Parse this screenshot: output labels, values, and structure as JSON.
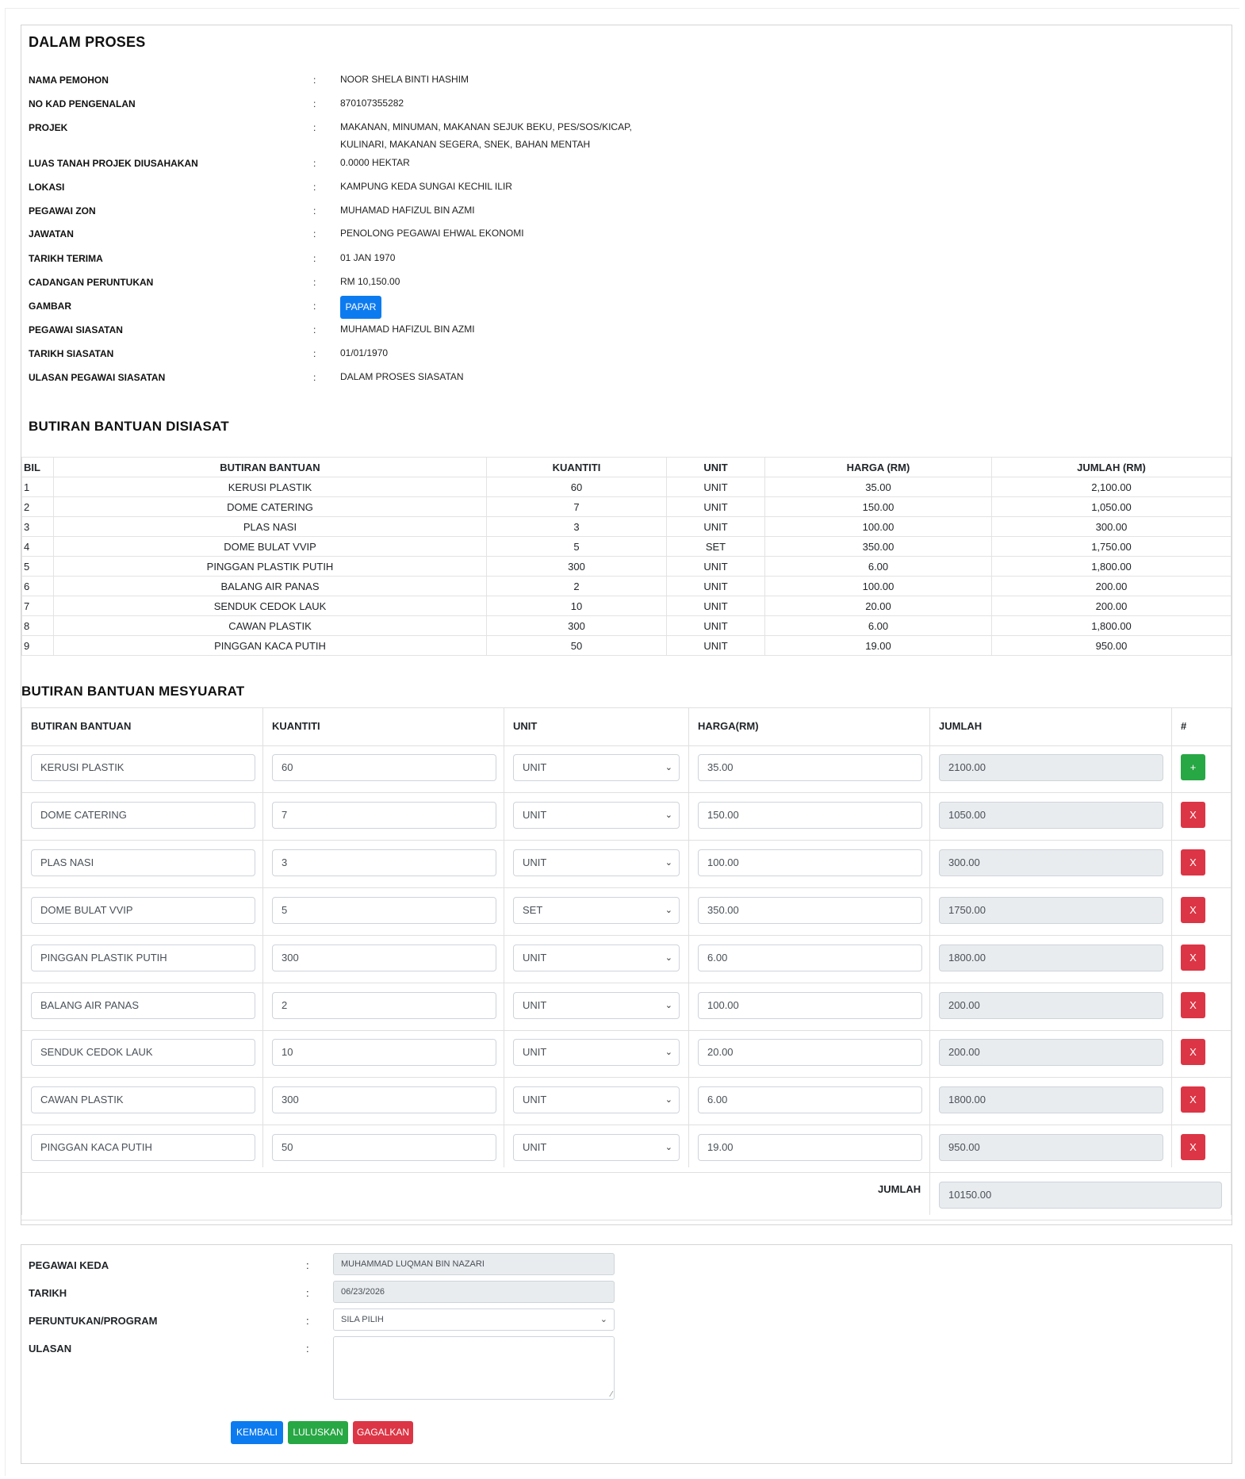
{
  "status_title": "DALAM PROSES",
  "info": [
    {
      "label": "NAMA PEMOHON",
      "value": "NOOR SHELA BINTI HASHIM"
    },
    {
      "label": "NO KAD PENGENALAN",
      "value": "870107355282"
    },
    {
      "label": "PROJEK",
      "value": "MAKANAN, MINUMAN, MAKANAN SEJUK BEKU, PES/SOS/KICAP, KULINARI, MAKANAN SEGERA, SNEK, BAHAN MENTAH"
    },
    {
      "label": "LUAS TANAH PROJEK DIUSAHAKAN",
      "value": "0.0000 HEKTAR"
    },
    {
      "label": "LOKASI",
      "value": "KAMPUNG KEDA SUNGAI KECHIL ILIR"
    },
    {
      "label": "PEGAWAI ZON",
      "value": "MUHAMAD HAFIZUL BIN AZMI"
    },
    {
      "label": "JAWATAN",
      "value": "PENOLONG PEGAWAI EHWAL EKONOMI"
    },
    {
      "label": "TARIKH TERIMA",
      "value": "01 JAN 1970"
    },
    {
      "label": "CADANGAN PERUNTUKAN",
      "value": "RM 10,150.00"
    },
    {
      "label": "GAMBAR",
      "value": ""
    },
    {
      "label": "PEGAWAI SIASATAN",
      "value": "MUHAMAD HAFIZUL BIN AZMI"
    },
    {
      "label": "TARIKH SIASATAN",
      "value": "01/01/1970"
    },
    {
      "label": "ULASAN PEGAWAI SIASATAN",
      "value": "DALAM PROSES SIASATAN"
    }
  ],
  "colon": ":",
  "papar_button": "PAPAR",
  "disiasat": {
    "title": "BUTIRAN BANTUAN DISIASAT",
    "headers": [
      "BIL",
      "BUTIRAN BANTUAN",
      "KUANTITI",
      "UNIT",
      "HARGA (RM)",
      "JUMLAH (RM)"
    ],
    "rows": [
      [
        "1",
        "KERUSI PLASTIK",
        "60",
        "UNIT",
        "35.00",
        "2,100.00"
      ],
      [
        "2",
        "DOME CATERING",
        "7",
        "UNIT",
        "150.00",
        "1,050.00"
      ],
      [
        "3",
        "PLAS NASI",
        "3",
        "UNIT",
        "100.00",
        "300.00"
      ],
      [
        "4",
        "DOME BULAT VVIP",
        "5",
        "SET",
        "350.00",
        "1,750.00"
      ],
      [
        "5",
        "PINGGAN PLASTIK PUTIH",
        "300",
        "UNIT",
        "6.00",
        "1,800.00"
      ],
      [
        "6",
        "BALANG AIR PANAS",
        "2",
        "UNIT",
        "100.00",
        "200.00"
      ],
      [
        "7",
        "SENDUK CEDOK LAUK",
        "10",
        "UNIT",
        "20.00",
        "200.00"
      ],
      [
        "8",
        "CAWAN PLASTIK",
        "300",
        "UNIT",
        "6.00",
        "1,800.00"
      ],
      [
        "9",
        "PINGGAN KACA PUTIH",
        "50",
        "UNIT",
        "19.00",
        "950.00"
      ]
    ]
  },
  "mesyuarat": {
    "title": "BUTIRAN BANTUAN MESYUARAT",
    "headers": [
      "BUTIRAN BANTUAN",
      "KUANTITI",
      "UNIT",
      "HARGA(RM)",
      "JUMLAH",
      "#"
    ],
    "rows": [
      {
        "item": "KERUSI PLASTIK",
        "qty": "60",
        "unit": "UNIT",
        "price": "35.00",
        "total": "2100.00",
        "action": "+"
      },
      {
        "item": "DOME CATERING",
        "qty": "7",
        "unit": "UNIT",
        "price": "150.00",
        "total": "1050.00",
        "action": "X"
      },
      {
        "item": "PLAS NASI",
        "qty": "3",
        "unit": "UNIT",
        "price": "100.00",
        "total": "300.00",
        "action": "X"
      },
      {
        "item": "DOME BULAT VVIP",
        "qty": "5",
        "unit": "SET",
        "price": "350.00",
        "total": "1750.00",
        "action": "X"
      },
      {
        "item": "PINGGAN PLASTIK PUTIH",
        "qty": "300",
        "unit": "UNIT",
        "price": "6.00",
        "total": "1800.00",
        "action": "X"
      },
      {
        "item": "BALANG AIR PANAS",
        "qty": "2",
        "unit": "UNIT",
        "price": "100.00",
        "total": "200.00",
        "action": "X"
      },
      {
        "item": "SENDUK CEDOK LAUK",
        "qty": "10",
        "unit": "UNIT",
        "price": "20.00",
        "total": "200.00",
        "action": "X"
      },
      {
        "item": "CAWAN PLASTIK",
        "qty": "300",
        "unit": "UNIT",
        "price": "6.00",
        "total": "1800.00",
        "action": "X"
      },
      {
        "item": "PINGGAN KACA PUTIH",
        "qty": "50",
        "unit": "UNIT",
        "price": "19.00",
        "total": "950.00",
        "action": "X"
      }
    ],
    "total_label": "JUMLAH",
    "total_value": "10150.00"
  },
  "approval": {
    "pegawai_label": "PEGAWAI KEDA",
    "pegawai_value": "MUHAMMAD LUQMAN BIN NAZARI",
    "tarikh_label": "TARIKH",
    "tarikh_value": "06/23/2026",
    "program_label": "PERUNTUKAN/PROGRAM",
    "program_value": "SILA PILIH",
    "ulasan_label": "ULASAN",
    "ulasan_value": "",
    "buttons": {
      "back": "KEMBALI",
      "approve": "LULUSKAN",
      "reject": "GAGALKAN"
    }
  },
  "colors": {
    "primary": "#0d7bf0",
    "success": "#28a745",
    "danger": "#dc3545",
    "readonly_bg": "#e9ecef"
  }
}
